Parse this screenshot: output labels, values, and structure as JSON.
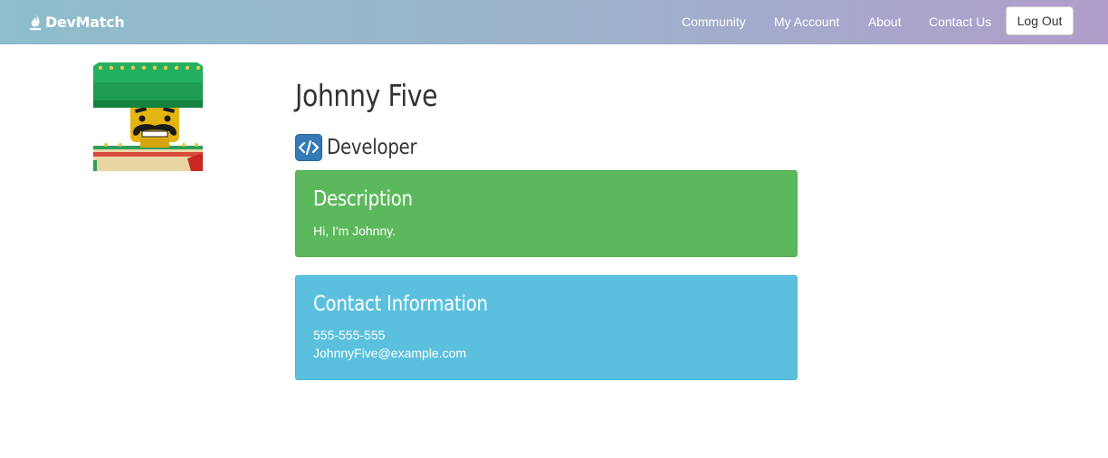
{
  "navbar": {
    "brand": "DevMatch",
    "links": [
      "Community",
      "My Account",
      "About",
      "Contact Us"
    ],
    "logout_label": "Log Out"
  },
  "profile": {
    "name": "Johnny Five",
    "role": "Developer",
    "role_icon": "code-icon",
    "description": {
      "title": "Description",
      "text": "Hi, I'm Johnny."
    },
    "contact": {
      "title": "Contact Information",
      "phone": "555-555-555",
      "email": "JohnnyFive@example.com"
    }
  },
  "colors": {
    "navbar_start": "#8ebdcc",
    "navbar_end": "#b19dcb",
    "description_panel": "#5cb85c",
    "contact_panel": "#5bc0de",
    "role_icon": "#337ab7"
  }
}
